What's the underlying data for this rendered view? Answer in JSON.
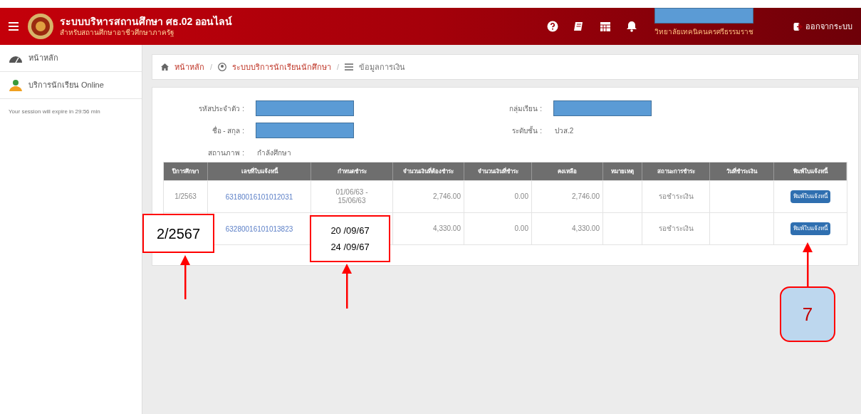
{
  "header": {
    "title": "ระบบบริหารสถานศึกษา ศธ.02 ออนไลน์",
    "subtitle": "สำหรับสถานศึกษาอาชีวศึกษาภาครัฐ",
    "school": "วิทยาลัยเทคนิคนครศรีธรรมราช",
    "logout": "ออกจากระบบ"
  },
  "sidebar": {
    "items": [
      {
        "label": "หน้าหลัก",
        "selected": false
      },
      {
        "label": "บริการนักเรียน Online",
        "selected": false
      }
    ],
    "session": "Your session will expire in 29:56 min"
  },
  "breadcrumb": [
    "หน้าหลัก",
    "ระบบบริการนักเรียนนักศึกษา",
    "ข้อมูลการเงิน"
  ],
  "breadcrumb_separator": "/",
  "profile": {
    "left": [
      {
        "label": "รหัสประจำตัว :",
        "kind": "redacted"
      },
      {
        "label": "ชื่อ - สกุล :",
        "kind": "redacted"
      },
      {
        "label": "สถานภาพ :",
        "kind": "text",
        "value": "กำลังศึกษา"
      }
    ],
    "right": [
      {
        "label": "กลุ่มเรียน :",
        "kind": "redacted"
      },
      {
        "label": "ระดับชั้น :",
        "kind": "text",
        "value": "ปวส.2"
      }
    ]
  },
  "table": {
    "columns": [
      "ปีการศึกษา",
      "เลขที่ใบแจ้งหนี้",
      "กำหนดชำระ",
      "จำนวนเงินที่ต้องชำระ",
      "จำนวนเงินที่ชำระ",
      "คงเหลือ",
      "หมายเหตุ",
      "สถานะการชำระ",
      "วันที่ชำระเงิน",
      "พิมพ์ใบแจ้งหนี้"
    ],
    "rows": [
      {
        "year": "1/2563",
        "invoice": "63180016101012031",
        "due": [
          "01/06/63 -",
          "15/06/63"
        ],
        "amount": "2,746.00",
        "paid": "0.00",
        "balance": "2,746.00",
        "status": "รอชำระเงิน",
        "print": "พิมพ์ใบแจ้งหนี้"
      },
      {
        "invoice": "63280016101013823",
        "amount": "4,330.00",
        "paid": "0.00",
        "balance": "4,330.00",
        "status": "รอชำระเงิน",
        "print": "พิมพ์ใบแจ้งหนี้"
      }
    ]
  },
  "annotations": [
    {
      "kind": "box",
      "lines": [
        "2/2567"
      ]
    },
    {
      "kind": "box",
      "lines": [
        "20 /09/67",
        "24 /09/67"
      ]
    },
    {
      "kind": "badge",
      "lines": [
        "7"
      ]
    }
  ]
}
